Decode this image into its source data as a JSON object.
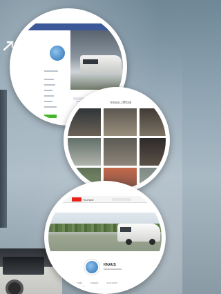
{
  "profile_bubble": {
    "page_name": "",
    "sidebar_links": [
      "",
      "",
      "",
      "",
      "",
      "",
      ""
    ],
    "tabs": [
      "",
      "",
      "",
      ""
    ]
  },
  "grid_bubble": {
    "title": "knaus_official",
    "photos": [
      {
        "colors": [
          "#2f3438",
          "#6b6257"
        ]
      },
      {
        "colors": [
          "#5b5750",
          "#9a8f7d"
        ]
      },
      {
        "colors": [
          "#3f3a34",
          "#7e7466"
        ]
      },
      {
        "colors": [
          "#62706a",
          "#b0b4ac"
        ]
      },
      {
        "colors": [
          "#5a5a54",
          "#8f857a"
        ]
      },
      {
        "colors": [
          "#2e2a2a",
          "#5b5148"
        ]
      },
      {
        "colors": [
          "#5e6f55",
          "#8ea07a"
        ]
      },
      {
        "colors": [
          "#c46a4a",
          "#6a4b4a"
        ]
      },
      {
        "colors": [
          "#7e8a84",
          "#a4a9a2"
        ]
      }
    ]
  },
  "video_bubble": {
    "site_word": "YouTube",
    "channel_name": "KNAUS",
    "nav_items": [
      "HOME",
      "VIDEOS",
      "PLAYLISTS"
    ]
  },
  "colors": {
    "facebook_blue": "#3b5998",
    "youtube_red": "#e62117",
    "accent_green": "#42b72a"
  }
}
